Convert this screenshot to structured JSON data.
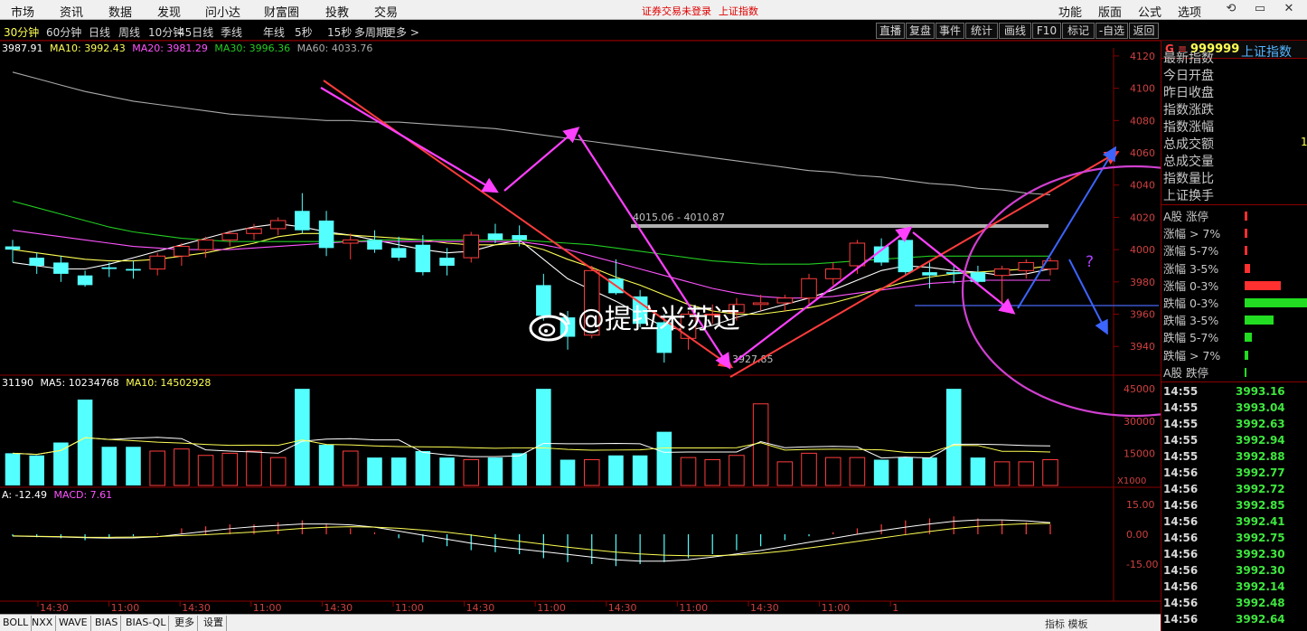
{
  "menu": {
    "items": [
      "市场",
      "资讯",
      "数据",
      "发现",
      "问小达",
      "财富圈",
      "投教",
      "交易"
    ],
    "login_notice": "证券交易未登录",
    "index_notice": "上证指数",
    "right_items": [
      "功能",
      "版面",
      "公式",
      "选项"
    ]
  },
  "toolbar": {
    "periods": [
      "30分钟",
      "60分钟",
      "日线",
      "周线",
      "10分钟",
      "45日线",
      "季线",
      "年线",
      "5秒",
      "15秒",
      "多周期",
      "更多 >"
    ],
    "active_period": "30分钟",
    "buttons": [
      "直播",
      "复盘",
      "事件",
      "统计",
      "画线",
      "F10",
      "标记",
      "-自选",
      "返回"
    ]
  },
  "ma_line": {
    "ma5": "3987.91",
    "ma10": "MA10: 3992.43",
    "ma20": "MA20: 3981.29",
    "ma30": "MA30: 3996.36",
    "ma60": "MA60: 4033.76"
  },
  "volume_line": {
    "vol": "31190",
    "ma5": "MA5: 10234768",
    "ma10": "MA10: 14502928"
  },
  "macd_line": {
    "a": "A: -12.49",
    "macd": "MACD: 7.61"
  },
  "chart_data": {
    "type": "candlestick",
    "price_ylim": [
      3925,
      4125
    ],
    "price_ticks": [
      "4120",
      "4100",
      "4080",
      "4060",
      "4040",
      "4020",
      "4000",
      "3980",
      "3960",
      "3940"
    ],
    "volume_ticks": [
      "45000",
      "30000",
      "15000"
    ],
    "volume_unit": "X1000",
    "macd_ticks": [
      "15.00",
      "0.00",
      "-15.00"
    ],
    "x_ticks": [
      "14:30",
      "11:00",
      "14:30",
      "11:00",
      "14:30",
      "11:00",
      "14:30",
      "11:00",
      "14:30",
      "11:00",
      "14:30",
      "11:00",
      "1"
    ],
    "annotations": {
      "resistance": "4015.06 - 4010.87",
      "low": "3927.85",
      "question": "?"
    },
    "candles": [
      {
        "o": 4002,
        "h": 4006,
        "l": 3992,
        "c": 4000
      },
      {
        "o": 3995,
        "h": 3998,
        "l": 3985,
        "c": 3990
      },
      {
        "o": 3992,
        "h": 3996,
        "l": 3980,
        "c": 3985
      },
      {
        "o": 3984,
        "h": 3987,
        "l": 3977,
        "c": 3978
      },
      {
        "o": 3989,
        "h": 3992,
        "l": 3983,
        "c": 3988
      },
      {
        "o": 3988,
        "h": 3993,
        "l": 3982,
        "c": 3987
      },
      {
        "o": 3988,
        "h": 3998,
        "l": 3984,
        "c": 3996
      },
      {
        "o": 3996,
        "h": 4004,
        "l": 3990,
        "c": 4002
      },
      {
        "o": 4000,
        "h": 4008,
        "l": 3995,
        "c": 4006
      },
      {
        "o": 4006,
        "h": 4012,
        "l": 4002,
        "c": 4010
      },
      {
        "o": 4010,
        "h": 4016,
        "l": 4006,
        "c": 4013
      },
      {
        "o": 4013,
        "h": 4020,
        "l": 4009,
        "c": 4018
      },
      {
        "o": 4024,
        "h": 4035,
        "l": 4010,
        "c": 4012
      },
      {
        "o": 4018,
        "h": 4024,
        "l": 3996,
        "c": 4001
      },
      {
        "o": 4004,
        "h": 4010,
        "l": 3994,
        "c": 4006
      },
      {
        "o": 4006,
        "h": 4012,
        "l": 3998,
        "c": 4000
      },
      {
        "o": 4001,
        "h": 4008,
        "l": 3993,
        "c": 3995
      },
      {
        "o": 4003,
        "h": 4009,
        "l": 3984,
        "c": 3986
      },
      {
        "o": 3995,
        "h": 4001,
        "l": 3984,
        "c": 3990
      },
      {
        "o": 3995,
        "h": 4011,
        "l": 3992,
        "c": 4009
      },
      {
        "o": 4010,
        "h": 4016,
        "l": 4004,
        "c": 4006
      },
      {
        "o": 4009,
        "h": 4015,
        "l": 4002,
        "c": 4006
      },
      {
        "o": 3978,
        "h": 3985,
        "l": 3956,
        "c": 3959
      },
      {
        "o": 3958,
        "h": 3962,
        "l": 3938,
        "c": 3946
      },
      {
        "o": 3947,
        "h": 3990,
        "l": 3945,
        "c": 3987
      },
      {
        "o": 3982,
        "h": 3994,
        "l": 3972,
        "c": 3973
      },
      {
        "o": 3971,
        "h": 3975,
        "l": 3952,
        "c": 3954
      },
      {
        "o": 3955,
        "h": 3960,
        "l": 3930,
        "c": 3936
      },
      {
        "o": 3945,
        "h": 3962,
        "l": 3938,
        "c": 3960
      },
      {
        "o": 3960,
        "h": 3966,
        "l": 3954,
        "c": 3960
      },
      {
        "o": 3961,
        "h": 3970,
        "l": 3956,
        "c": 3966
      },
      {
        "o": 3966,
        "h": 3972,
        "l": 3962,
        "c": 3967
      },
      {
        "o": 3967,
        "h": 3972,
        "l": 3962,
        "c": 3970
      },
      {
        "o": 3970,
        "h": 3985,
        "l": 3966,
        "c": 3982
      },
      {
        "o": 3982,
        "h": 3992,
        "l": 3978,
        "c": 3988
      },
      {
        "o": 3990,
        "h": 4006,
        "l": 3985,
        "c": 4004
      },
      {
        "o": 4002,
        "h": 4007,
        "l": 3990,
        "c": 3992
      },
      {
        "o": 4006,
        "h": 4008,
        "l": 3984,
        "c": 3986
      },
      {
        "o": 3986,
        "h": 3992,
        "l": 3976,
        "c": 3984
      },
      {
        "o": 3986,
        "h": 3990,
        "l": 3979,
        "c": 3985
      },
      {
        "o": 3986,
        "h": 3990,
        "l": 3978,
        "c": 3980
      },
      {
        "o": 3984,
        "h": 3990,
        "l": 3965,
        "c": 3988
      },
      {
        "o": 3987,
        "h": 3994,
        "l": 3982,
        "c": 3992
      },
      {
        "o": 3988,
        "h": 3995,
        "l": 3984,
        "c": 3993
      }
    ],
    "volumes": [
      15,
      14,
      20,
      40,
      18,
      18,
      16,
      17,
      14,
      15,
      16,
      13,
      45,
      19,
      16,
      13,
      13,
      16,
      13,
      12,
      13,
      15,
      45,
      12,
      12,
      14,
      14,
      25,
      13,
      12,
      14,
      38,
      11,
      15,
      13,
      13,
      12,
      13,
      13,
      45,
      13,
      11,
      11,
      12
    ],
    "macd_bars": [
      -1,
      -1.5,
      -2,
      -3,
      -2,
      -1,
      0.5,
      3,
      4,
      5,
      5,
      6,
      7,
      5,
      3,
      1,
      -2,
      -4,
      -6,
      -8,
      -9,
      -10,
      -12,
      -14,
      -15,
      -16,
      -15,
      -14,
      -12,
      -10,
      -8,
      -6,
      -3,
      -1,
      1,
      3,
      5,
      7,
      8,
      9,
      8,
      7,
      6,
      5
    ],
    "ma_series": [
      {
        "name": "MA5",
        "color": "#ffffff",
        "values": [
          3992,
          3990,
          3988,
          3988,
          3991,
          3995,
          3999,
          4003,
          4007,
          4011,
          4014,
          4016,
          4014,
          4011,
          4009,
          4006,
          4003,
          4000,
          3998,
          3999,
          4003,
          4006,
          3994,
          3982,
          3975,
          3968,
          3960,
          3952,
          3950,
          3953,
          3958,
          3962,
          3966,
          3970,
          3975,
          3981,
          3987,
          3990,
          3989,
          3987,
          3986,
          3984,
          3985,
          3988
        ]
      },
      {
        "name": "MA10",
        "color": "#ffff54",
        "values": [
          4000,
          3998,
          3996,
          3994,
          3993,
          3993,
          3994,
          3996,
          3998,
          4001,
          4004,
          4008,
          4010,
          4010,
          4009,
          4008,
          4007,
          4006,
          4004,
          4003,
          4003,
          4004,
          4000,
          3994,
          3989,
          3983,
          3978,
          3972,
          3966,
          3962,
          3960,
          3960,
          3962,
          3964,
          3967,
          3971,
          3976,
          3980,
          3983,
          3985,
          3986,
          3987,
          3988,
          3990
        ]
      },
      {
        "name": "MA20",
        "color": "#ff54ff",
        "values": [
          4012,
          4010,
          4008,
          4006,
          4004,
          4002,
          4001,
          4000,
          4000,
          4000,
          4001,
          4002,
          4003,
          4004,
          4005,
          4005,
          4005,
          4005,
          4005,
          4005,
          4005,
          4005,
          4003,
          4000,
          3996,
          3992,
          3988,
          3984,
          3980,
          3976,
          3973,
          3971,
          3970,
          3970,
          3971,
          3973,
          3975,
          3977,
          3979,
          3980,
          3981,
          3981,
          3981,
          3981
        ]
      },
      {
        "name": "MA30",
        "color": "#22cc22",
        "values": [
          4030,
          4026,
          4022,
          4018,
          4014,
          4011,
          4009,
          4007,
          4006,
          4005,
          4005,
          4005,
          4005,
          4005,
          4005,
          4006,
          4006,
          4006,
          4006,
          4006,
          4006,
          4006,
          4005,
          4004,
          4003,
          4001,
          3999,
          3997,
          3995,
          3993,
          3992,
          3991,
          3991,
          3991,
          3992,
          3993,
          3994,
          3995,
          3996,
          3996,
          3996,
          3996,
          3996,
          3996
        ]
      },
      {
        "name": "MA60",
        "color": "#aaaaaa",
        "values": [
          4110,
          4106,
          4102,
          4098,
          4095,
          4092,
          4090,
          4088,
          4086,
          4084,
          4083,
          4082,
          4081,
          4080,
          4080,
          4079,
          4079,
          4078,
          4077,
          4076,
          4075,
          4073,
          4071,
          4069,
          4067,
          4065,
          4063,
          4061,
          4059,
          4057,
          4055,
          4053,
          4051,
          4049,
          4048,
          4046,
          4045,
          4043,
          4041,
          4040,
          4038,
          4037,
          4035,
          4034
        ]
      }
    ]
  },
  "right_panel": {
    "logo": "G",
    "menu_icon": "≡",
    "code": "999999",
    "name": "上证指数",
    "stats": [
      "最新指数",
      "今日开盘",
      "昨日收盘",
      "指数涨跌",
      "指数涨幅",
      "总成交额",
      "总成交量",
      "指数量比",
      "上证换手"
    ],
    "stat_value_partial": "1",
    "distribution": [
      {
        "label": "A股 涨停",
        "color": "#ff3030",
        "width": 3
      },
      {
        "label": "涨幅 > 7%",
        "color": "#ff3030",
        "width": 3
      },
      {
        "label": "涨幅 5-7%",
        "color": "#ff3030",
        "width": 3
      },
      {
        "label": "涨幅 3-5%",
        "color": "#ff3030",
        "width": 6
      },
      {
        "label": "涨幅 0-3%",
        "color": "#ff3030",
        "width": 40
      },
      {
        "label": "跌幅 0-3%",
        "color": "#22dd22",
        "width": 70
      },
      {
        "label": "跌幅 3-5%",
        "color": "#22dd22",
        "width": 32
      },
      {
        "label": "跌幅 5-7%",
        "color": "#22dd22",
        "width": 8
      },
      {
        "label": "跌幅 > 7%",
        "color": "#22dd22",
        "width": 4
      },
      {
        "label": "A股 跌停",
        "color": "#22dd22",
        "width": 2
      }
    ],
    "ticks": [
      {
        "t": "14:55",
        "p": "3993.16"
      },
      {
        "t": "14:55",
        "p": "3993.04"
      },
      {
        "t": "14:55",
        "p": "3992.63"
      },
      {
        "t": "14:55",
        "p": "3992.94"
      },
      {
        "t": "14:55",
        "p": "3992.88"
      },
      {
        "t": "14:56",
        "p": "3992.77"
      },
      {
        "t": "14:56",
        "p": "3992.72"
      },
      {
        "t": "14:56",
        "p": "3992.85"
      },
      {
        "t": "14:56",
        "p": "3992.41"
      },
      {
        "t": "14:56",
        "p": "3992.75"
      },
      {
        "t": "14:56",
        "p": "3992.30"
      },
      {
        "t": "14:56",
        "p": "3992.30"
      },
      {
        "t": "14:56",
        "p": "3992.14"
      },
      {
        "t": "14:56",
        "p": "3992.48"
      },
      {
        "t": "14:56",
        "p": "3992.64"
      }
    ]
  },
  "bottom_tabs": [
    "BOLL",
    "NXX",
    "WAVE",
    "BIAS",
    "BIAS-QL",
    "更多",
    "设置"
  ],
  "bottom_right": "指标  模板",
  "watermark": "@提拉米苏过"
}
